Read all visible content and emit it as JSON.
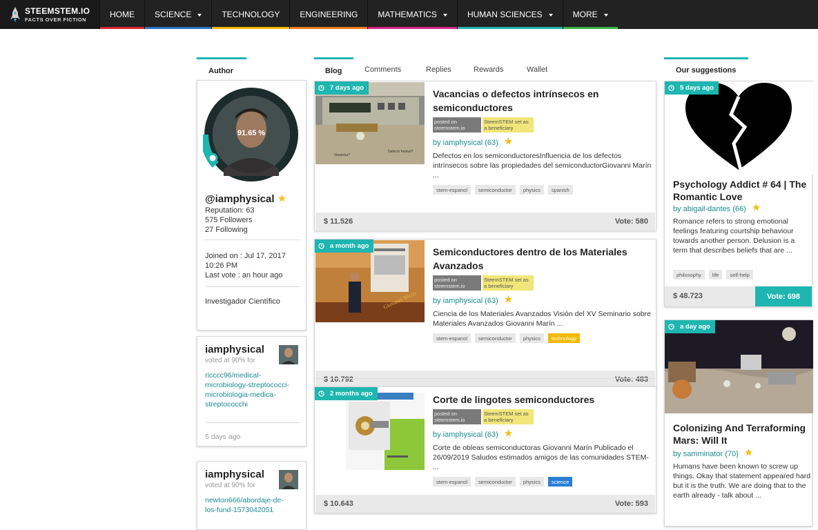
{
  "brand": {
    "name": "STEEMSTEM.IO",
    "tagline": "FACTS OVER FICTION"
  },
  "nav": [
    {
      "label": "HOME",
      "color": "#d9262b",
      "caret": false
    },
    {
      "label": "SCIENCE",
      "color": "#2775c9",
      "caret": true
    },
    {
      "label": "TECHNOLOGY",
      "color": "#f5b800",
      "caret": false
    },
    {
      "label": "ENGINEERING",
      "color": "#f07d1a",
      "caret": false
    },
    {
      "label": "MATHEMATICS",
      "color": "#d6238a",
      "caret": true
    },
    {
      "label": "HUMAN SCIENCES",
      "color": "#1fb5b0",
      "caret": true
    },
    {
      "label": "MORE",
      "color": "#3ab54a",
      "caret": true
    }
  ],
  "author_section": {
    "header": "Author"
  },
  "author": {
    "percent": "91.65 %",
    "handle": "@iamphysical",
    "reputation": "Reputation: 63",
    "followers": "575 Followers",
    "following": "27 Following",
    "joined_line1": "Joined on : Jul 17, 2017",
    "joined_line2": "10:26 PM",
    "last_vote": "Last vote : an hour ago",
    "bio": "Investigador Científico"
  },
  "votes": [
    {
      "name": "iamphysical",
      "meta": "voted at 90% for",
      "link": "ricccc96/medical-microbiology-streptococci-microbiologia-medica-streptococchi",
      "time": "5 days ago"
    },
    {
      "name": "iamphysical",
      "meta": "voted at 90% for",
      "link": "newton666/abordaje-de-los-fund-1573042051",
      "time": ""
    }
  ],
  "tabs": [
    "Blog",
    "Comments",
    "Replies",
    "Rewards",
    "Wallet"
  ],
  "badges": {
    "posted_on": "posted on steemstem.io",
    "beneficiary": "SteemSTEM set as a beneficiary"
  },
  "posts": [
    {
      "time": "7 days ago",
      "title": "Vacancias o defectos intrínsecos en semiconductores",
      "author": "by iamphysical (63)",
      "excerpt": "Defectos en los semiconductoresInfluencia de los defectos intrínsecos sobre las propiedades del semiconductorGiovanni Marín ...",
      "tags": [
        "stem-espanol",
        "semiconductor",
        "physics",
        "spanish"
      ],
      "amount": "$ 11.526",
      "vote": "Vote: 580"
    },
    {
      "time": "a month ago",
      "title": "Semiconductores dentro de los Materiales Avanzados",
      "author": "by iamphysical (63)",
      "excerpt": "Ciencia de los Materiales Avanzados Visión del XV Seminario sobre Materiales Avanzados Giovanni Marín ...",
      "tags": [
        "stem-espanol",
        "semiconductor",
        "physics",
        "technology"
      ],
      "amount": "$ 10.792",
      "vote": "Vote: 483"
    },
    {
      "time": "2 months ago",
      "title": "Corte de lingotes semiconductores",
      "author": "by iamphysical (63)",
      "excerpt": "Corte de obleas semiconductoras Giovanni Marín Publicado el 26/09/2019 Saludos estimados amigos de las comunidades STEM- ...",
      "tags": [
        "stem-espanol",
        "semiconductor",
        "physics",
        "science"
      ],
      "amount": "$ 10.643",
      "vote": "Vote: 593"
    }
  ],
  "suggestions_section": {
    "header": "Our suggestions"
  },
  "suggestions": [
    {
      "time": "5 days ago",
      "title": "Psychology Addict # 64 | The Romantic Love",
      "author": "by abigail-dantes (66)",
      "excerpt": "Romance refers to strong emotional feelings featuring courtship behaviour towards another person. Delusion is a term that describes beliefs that are ...",
      "tags": [
        "philosophy",
        "life",
        "self-help"
      ],
      "amount": "$ 48.723",
      "vote": "Vote: 698"
    },
    {
      "time": "a day ago",
      "title": "Colonizing And Terraforming Mars: Will It",
      "author": "by samminator (70)",
      "excerpt": "Humans have been known to screw up things. Okay that statement appeared hard but it is the truth. We are doing that to the earth already - talk about ..."
    }
  ]
}
